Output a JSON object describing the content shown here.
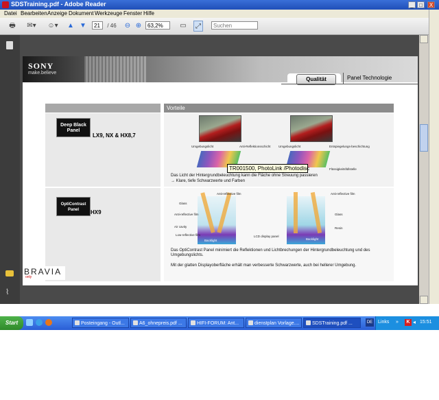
{
  "window": {
    "title": "SDSTraining.pdf - Adobe Reader",
    "buttons": [
      "_",
      "□",
      "X"
    ]
  },
  "menu": [
    "Datei",
    "Bearbeiten",
    "Anzeige",
    "Dokument",
    "Werkzeuge",
    "Fenster",
    "Hilfe"
  ],
  "toolbar": {
    "page_current": "21",
    "page_total": "/ 46",
    "zoom": "63,2%",
    "search_placeholder": "Suchen"
  },
  "slide": {
    "brand": "SONY",
    "tagline": "make.believe",
    "tab_active": "Qualität",
    "tab_title": "Panel Technologie",
    "advantages_header": "Vorteile",
    "rows": [
      {
        "badge_line1": "Deep Black",
        "badge_line2": "Panel",
        "models": "LX9, NX & HX8,7",
        "labels": [
          "Umgebungslicht",
          "Anti-Reflektionsschicht",
          "Umgebungslicht",
          "Entspiegelungs-beschichtung",
          "Flüssigkeitsfüllstelle"
        ],
        "desc_line1": "Das Licht der Hintergrundbeleuchtung kann die Fläche ohne Streuung passieren",
        "desc_line2": "→ Klare, tiefe Schwarzwerte und Farben"
      },
      {
        "badge_line1": "OptiContrast",
        "badge_line2": "Panel",
        "models": "HX9",
        "labels": [
          "Anti-reflective film",
          "Glass",
          "Anti-reflective film",
          "Air cavity",
          "Low-reflective film",
          "Backlight",
          "LCD display panel",
          "Anti-reflective film",
          "Glass",
          "Resin",
          "Backlight"
        ],
        "desc_line1": "Das OptiContrast Panel minimiert die Reflektionen und Lichtbrechungen der Hintergrundbeleuchtung und des",
        "desc_line2": "Umgebungslichts.",
        "desc_line3": "Mit der glatten Displayoberfläche erhält man verbesserte Schwarzwerte, auch bei hellerer Umgebung."
      }
    ],
    "bravia": "BRAVIA",
    "bravia_sub": "only"
  },
  "tooltip": "TR001500, PhotoLink /Photodisc",
  "taskbar": {
    "start": "Start",
    "tasks": [
      "Posteingang - Outl...",
      "A6_ohnepreis.pdf ...",
      "HIFI-FORUM: Ant...",
      "dienstplan Vorlage....",
      "SDSTraining.pdf ..."
    ],
    "lang": "DE",
    "links": "Links",
    "clock": "15:51"
  }
}
